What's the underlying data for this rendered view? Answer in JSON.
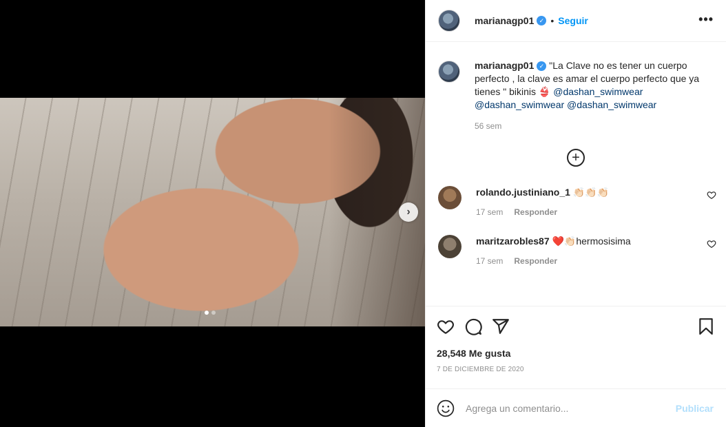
{
  "post": {
    "username": "marianagp01",
    "follow_label": "Seguir",
    "separator": "•",
    "more_icon": "more-horizontal-icon",
    "carousel": {
      "total": 2,
      "current": 1
    }
  },
  "caption": {
    "username": "marianagp01",
    "text_part1": " \"La Clave no es tener un cuerpo perfecto , la clave es amar el cuerpo perfecto que ya tienes \" bikinis ",
    "emoji": "👙",
    "mention1": "@dashan_swimwear",
    "mention2": "@dashan_swimwear",
    "mention3": "@dashan_swimwear",
    "time": "56 sem"
  },
  "comments": [
    {
      "username": "rolando.justiniano_1",
      "text": " 👏🏻👏🏻👏🏻",
      "time": "17 sem",
      "reply_label": "Responder"
    },
    {
      "username": "maritzarobles87",
      "text": " ❤️👏🏻hermosisima",
      "time": "17 sem",
      "reply_label": "Responder"
    }
  ],
  "actions": {
    "likes": "28,548 Me gusta",
    "date": "7 DE DICIEMBRE DE 2020"
  },
  "add_comment": {
    "placeholder": "Agrega un comentario...",
    "publish_label": "Publicar"
  },
  "colors": {
    "accent": "#0095f6",
    "publish_disabled": "#b2dffc",
    "verified": "#3897f0",
    "mention": "#00376b"
  }
}
